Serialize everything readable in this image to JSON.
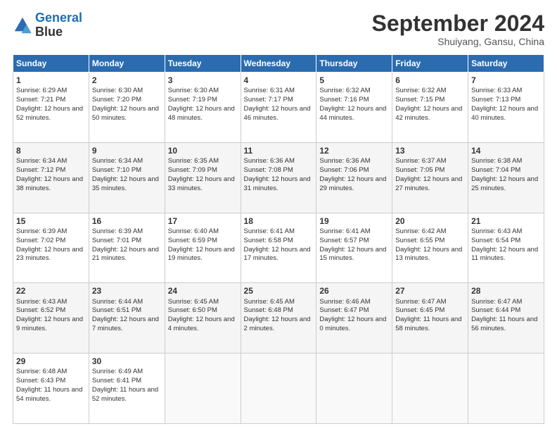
{
  "header": {
    "logo_line1": "General",
    "logo_line2": "Blue",
    "month": "September 2024",
    "location": "Shuiyang, Gansu, China"
  },
  "weekdays": [
    "Sunday",
    "Monday",
    "Tuesday",
    "Wednesday",
    "Thursday",
    "Friday",
    "Saturday"
  ],
  "weeks": [
    [
      {
        "day": "1",
        "sunrise": "6:29 AM",
        "sunset": "7:21 PM",
        "daylight": "12 hours and 52 minutes."
      },
      {
        "day": "2",
        "sunrise": "6:30 AM",
        "sunset": "7:20 PM",
        "daylight": "12 hours and 50 minutes."
      },
      {
        "day": "3",
        "sunrise": "6:30 AM",
        "sunset": "7:19 PM",
        "daylight": "12 hours and 48 minutes."
      },
      {
        "day": "4",
        "sunrise": "6:31 AM",
        "sunset": "7:17 PM",
        "daylight": "12 hours and 46 minutes."
      },
      {
        "day": "5",
        "sunrise": "6:32 AM",
        "sunset": "7:16 PM",
        "daylight": "12 hours and 44 minutes."
      },
      {
        "day": "6",
        "sunrise": "6:32 AM",
        "sunset": "7:15 PM",
        "daylight": "12 hours and 42 minutes."
      },
      {
        "day": "7",
        "sunrise": "6:33 AM",
        "sunset": "7:13 PM",
        "daylight": "12 hours and 40 minutes."
      }
    ],
    [
      {
        "day": "8",
        "sunrise": "6:34 AM",
        "sunset": "7:12 PM",
        "daylight": "12 hours and 38 minutes."
      },
      {
        "day": "9",
        "sunrise": "6:34 AM",
        "sunset": "7:10 PM",
        "daylight": "12 hours and 35 minutes."
      },
      {
        "day": "10",
        "sunrise": "6:35 AM",
        "sunset": "7:09 PM",
        "daylight": "12 hours and 33 minutes."
      },
      {
        "day": "11",
        "sunrise": "6:36 AM",
        "sunset": "7:08 PM",
        "daylight": "12 hours and 31 minutes."
      },
      {
        "day": "12",
        "sunrise": "6:36 AM",
        "sunset": "7:06 PM",
        "daylight": "12 hours and 29 minutes."
      },
      {
        "day": "13",
        "sunrise": "6:37 AM",
        "sunset": "7:05 PM",
        "daylight": "12 hours and 27 minutes."
      },
      {
        "day": "14",
        "sunrise": "6:38 AM",
        "sunset": "7:04 PM",
        "daylight": "12 hours and 25 minutes."
      }
    ],
    [
      {
        "day": "15",
        "sunrise": "6:39 AM",
        "sunset": "7:02 PM",
        "daylight": "12 hours and 23 minutes."
      },
      {
        "day": "16",
        "sunrise": "6:39 AM",
        "sunset": "7:01 PM",
        "daylight": "12 hours and 21 minutes."
      },
      {
        "day": "17",
        "sunrise": "6:40 AM",
        "sunset": "6:59 PM",
        "daylight": "12 hours and 19 minutes."
      },
      {
        "day": "18",
        "sunrise": "6:41 AM",
        "sunset": "6:58 PM",
        "daylight": "12 hours and 17 minutes."
      },
      {
        "day": "19",
        "sunrise": "6:41 AM",
        "sunset": "6:57 PM",
        "daylight": "12 hours and 15 minutes."
      },
      {
        "day": "20",
        "sunrise": "6:42 AM",
        "sunset": "6:55 PM",
        "daylight": "12 hours and 13 minutes."
      },
      {
        "day": "21",
        "sunrise": "6:43 AM",
        "sunset": "6:54 PM",
        "daylight": "12 hours and 11 minutes."
      }
    ],
    [
      {
        "day": "22",
        "sunrise": "6:43 AM",
        "sunset": "6:52 PM",
        "daylight": "12 hours and 9 minutes."
      },
      {
        "day": "23",
        "sunrise": "6:44 AM",
        "sunset": "6:51 PM",
        "daylight": "12 hours and 7 minutes."
      },
      {
        "day": "24",
        "sunrise": "6:45 AM",
        "sunset": "6:50 PM",
        "daylight": "12 hours and 4 minutes."
      },
      {
        "day": "25",
        "sunrise": "6:45 AM",
        "sunset": "6:48 PM",
        "daylight": "12 hours and 2 minutes."
      },
      {
        "day": "26",
        "sunrise": "6:46 AM",
        "sunset": "6:47 PM",
        "daylight": "12 hours and 0 minutes."
      },
      {
        "day": "27",
        "sunrise": "6:47 AM",
        "sunset": "6:45 PM",
        "daylight": "11 hours and 58 minutes."
      },
      {
        "day": "28",
        "sunrise": "6:47 AM",
        "sunset": "6:44 PM",
        "daylight": "11 hours and 56 minutes."
      }
    ],
    [
      {
        "day": "29",
        "sunrise": "6:48 AM",
        "sunset": "6:43 PM",
        "daylight": "11 hours and 54 minutes."
      },
      {
        "day": "30",
        "sunrise": "6:49 AM",
        "sunset": "6:41 PM",
        "daylight": "11 hours and 52 minutes."
      },
      null,
      null,
      null,
      null,
      null
    ]
  ]
}
